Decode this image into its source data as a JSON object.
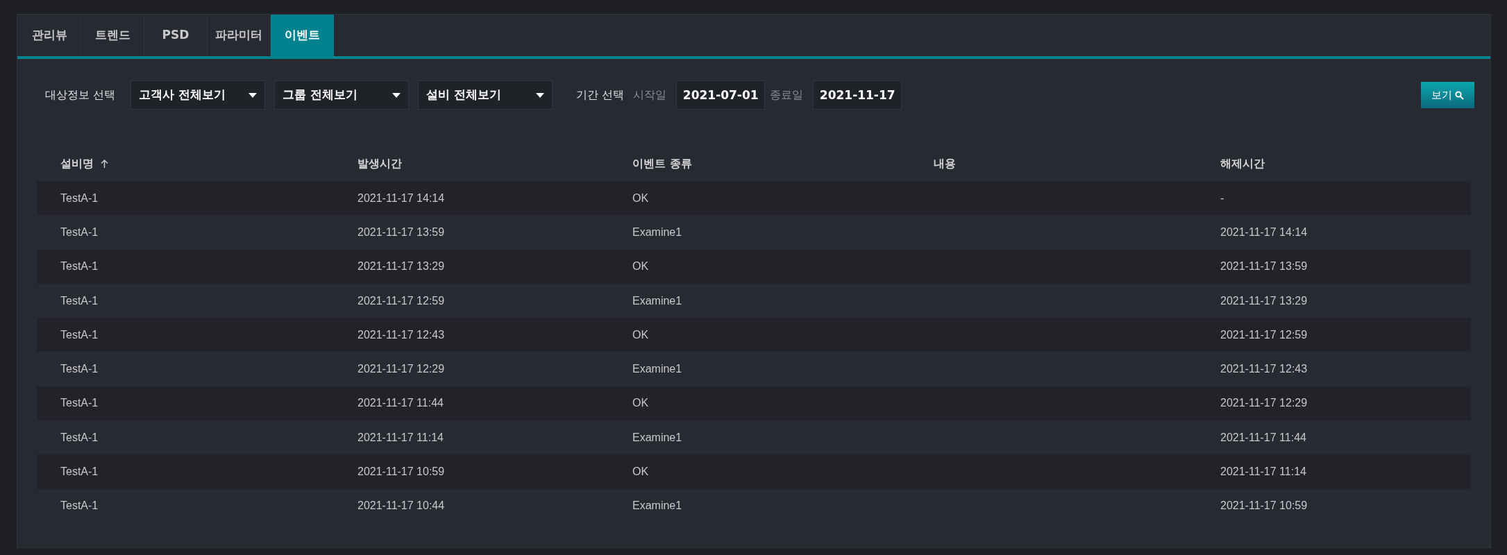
{
  "tabs": [
    {
      "label": "관리뷰",
      "selected": false
    },
    {
      "label": "트렌드",
      "selected": false
    },
    {
      "label": "PSD",
      "selected": false
    },
    {
      "label": "파라미터",
      "selected": false
    },
    {
      "label": "이벤트",
      "selected": true
    }
  ],
  "filters": {
    "target_label": "대상정보 선택",
    "dropdowns": [
      "고객사 전체보기",
      "그룹 전체보기",
      "설비 전체보기"
    ],
    "period_label": "기간 선택",
    "start_label": "시작일",
    "start_date": "2021-07-01",
    "end_label": "종료일",
    "end_date": "2021-11-17",
    "view_button": "보기"
  },
  "table": {
    "columns": [
      {
        "label": "설비명",
        "sorted_ascending": true
      },
      {
        "label": "발생시간",
        "sorted_ascending": false
      },
      {
        "label": "이벤트 종류",
        "sorted_ascending": false
      },
      {
        "label": "내용",
        "sorted_ascending": false
      },
      {
        "label": "해제시간",
        "sorted_ascending": false
      }
    ],
    "rows": [
      [
        "TestA-1",
        "2021-11-17 14:14",
        "OK",
        "",
        "-"
      ],
      [
        "TestA-1",
        "2021-11-17 13:59",
        "Examine1",
        "",
        "2021-11-17 14:14"
      ],
      [
        "TestA-1",
        "2021-11-17 13:29",
        "OK",
        "",
        "2021-11-17 13:59"
      ],
      [
        "TestA-1",
        "2021-11-17 12:59",
        "Examine1",
        "",
        "2021-11-17 13:29"
      ],
      [
        "TestA-1",
        "2021-11-17 12:43",
        "OK",
        "",
        "2021-11-17 12:59"
      ],
      [
        "TestA-1",
        "2021-11-17 12:29",
        "Examine1",
        "",
        "2021-11-17 12:43"
      ],
      [
        "TestA-1",
        "2021-11-17 11:44",
        "OK",
        "",
        "2021-11-17 12:29"
      ],
      [
        "TestA-1",
        "2021-11-17 11:14",
        "Examine1",
        "",
        "2021-11-17 11:44"
      ],
      [
        "TestA-1",
        "2021-11-17 10:59",
        "OK",
        "",
        "2021-11-17 11:14"
      ],
      [
        "TestA-1",
        "2021-11-17 10:44",
        "Examine1",
        "",
        "2021-11-17 10:59"
      ]
    ]
  }
}
